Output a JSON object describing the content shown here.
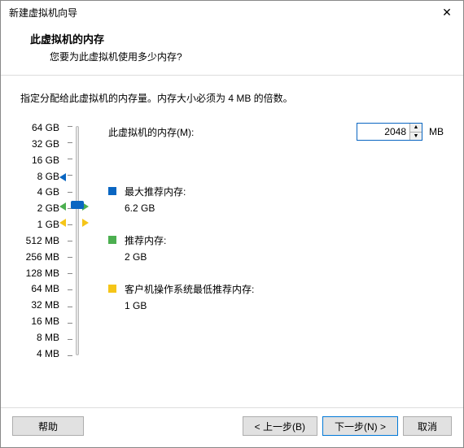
{
  "titlebar": {
    "title": "新建虚拟机向导"
  },
  "header": {
    "title": "此虚拟机的内存",
    "subtitle": "您要为此虚拟机使用多少内存?"
  },
  "instruction": "指定分配给此虚拟机的内存量。内存大小必须为 4 MB 的倍数。",
  "memory": {
    "label": "此虚拟机的内存(M):",
    "value": "2048",
    "unit": "MB"
  },
  "slider": {
    "labels": [
      "64 GB",
      "32 GB",
      "16 GB",
      "8 GB",
      "4 GB",
      "2 GB",
      "1 GB",
      "512 MB",
      "256 MB",
      "128 MB",
      "64 MB",
      "32 MB",
      "16 MB",
      "8 MB",
      "4 MB"
    ]
  },
  "legend": {
    "max": {
      "label": "最大推荐内存:",
      "value": "6.2 GB"
    },
    "rec": {
      "label": "推荐内存:",
      "value": "2 GB"
    },
    "min": {
      "label": "客户机操作系统最低推荐内存:",
      "value": "1 GB"
    }
  },
  "footer": {
    "help": "帮助",
    "back": "< 上一步(B)",
    "next": "下一步(N) >",
    "cancel": "取消"
  }
}
